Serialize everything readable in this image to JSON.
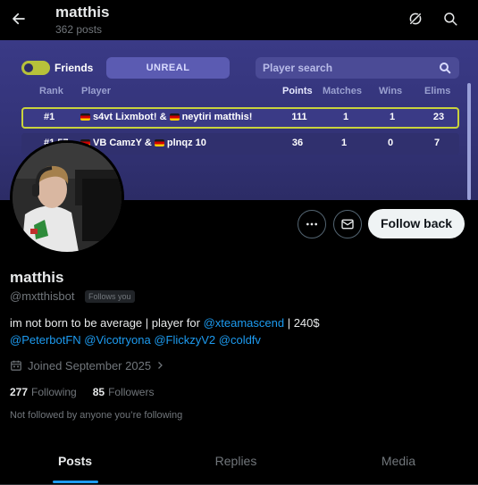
{
  "header": {
    "title": "matthis",
    "post_count": "362 posts"
  },
  "banner": {
    "filter_label": "Friends",
    "mode_label": "UNREAL",
    "search_placeholder": "Player search",
    "columns": [
      "Rank",
      "Player",
      "Points",
      "Matches",
      "Wins",
      "Elims"
    ],
    "rows": [
      {
        "rank": "#1",
        "player_a": "s4vt Lixmbot! &",
        "player_b": "neytiri matthis!",
        "points": "111",
        "matches": "1",
        "wins": "1",
        "elims": "23"
      },
      {
        "rank": "#1,57",
        "player_a": "VB CamzY &",
        "player_b": "plnqz 10",
        "points": "36",
        "matches": "1",
        "wins": "0",
        "elims": "7"
      }
    ],
    "colors": {
      "highlight_border": "#c9d33d",
      "background": "#34347a"
    }
  },
  "actions": {
    "follow_label": "Follow back"
  },
  "profile": {
    "name": "matthis",
    "handle": "@mxtthisbot",
    "follows_you": "Follows you",
    "bio_prefix": "im not born to be average | player for ",
    "bio_mention": "@xteamascend",
    "bio_suffix": " | 240$",
    "mentions": [
      "@PeterbotFN",
      "@Vicotryona",
      "@FlickzyV2",
      "@coldfv"
    ],
    "joined": "Joined September 2025",
    "following_count": "277",
    "following_label": "Following",
    "followers_count": "85",
    "followers_label": "Followers",
    "mutual_note": "Not followed by anyone you’re following"
  },
  "tabs": [
    {
      "label": "Posts",
      "active": true
    },
    {
      "label": "Replies",
      "active": false
    },
    {
      "label": "Media",
      "active": false
    }
  ],
  "accent": "#1d9bf0"
}
